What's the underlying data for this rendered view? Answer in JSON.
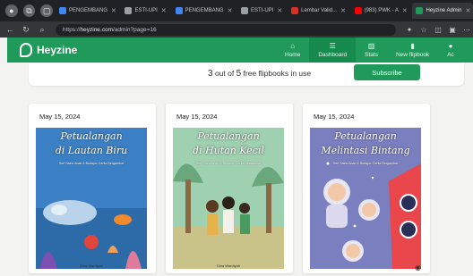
{
  "browser": {
    "tabs": [
      {
        "label": "PENGEMBANG",
        "color": "#4285f4"
      },
      {
        "label": "ESTI-UPI",
        "color": "#9aa0a6"
      },
      {
        "label": "PENGEMBANG",
        "color": "#4285f4"
      },
      {
        "label": "ESTI-UPI",
        "color": "#9aa0a6"
      },
      {
        "label": "Lembar Valid...",
        "color": "#d93025"
      },
      {
        "label": "(983) PWK - A",
        "color": "#ff0000"
      },
      {
        "label": "Heyzine Admin",
        "color": "#1f9a5a"
      }
    ],
    "url_host": "heyzine.com",
    "url_path": "/admin?page=16",
    "url_prefix": "https://"
  },
  "app": {
    "logo": "Heyzine",
    "nav": [
      {
        "icon": "home-icon",
        "label": "Home",
        "glyph": "⌂"
      },
      {
        "icon": "dashboard-icon",
        "label": "Dashboard",
        "glyph": "☰"
      },
      {
        "icon": "stats-icon",
        "label": "Stats",
        "glyph": "▥"
      },
      {
        "icon": "new-flipbook-icon",
        "label": "New flipbook",
        "glyph": "▮"
      },
      {
        "icon": "account-icon",
        "label": "Ac",
        "glyph": "●"
      }
    ]
  },
  "quota": {
    "used": "3",
    "middle": "out of",
    "total": "5",
    "suffix": "free flipbooks in use",
    "subscribe_label": "Subscribe"
  },
  "cards": [
    {
      "date": "May 15, 2024",
      "title_1": "Petualangan",
      "title_2": "di Lautan Biru",
      "subtitle": "Seri Sains Anak & Budaya: Cerita Bergambar",
      "author": "Dina Wardiyah"
    },
    {
      "date": "May 15, 2024",
      "title_1": "Petualangan",
      "title_2": "di Hutan Kecil",
      "subtitle": "Seri Sains Anak & Budaya: Cerita Bergambar",
      "author": "Dina Wardiyah"
    },
    {
      "date": "May 15, 2024",
      "title_1": "Petualangan",
      "title_2": "Melintasi Bintang",
      "subtitle": "Seri Sains Anak & Budaya: Cerita Bergambar",
      "author": ""
    }
  ],
  "colors": {
    "brand_green": "#1f9a5a",
    "ocean": "#3b7fc4",
    "forest": "#8fc4a2",
    "space": "#7a7fc0"
  }
}
